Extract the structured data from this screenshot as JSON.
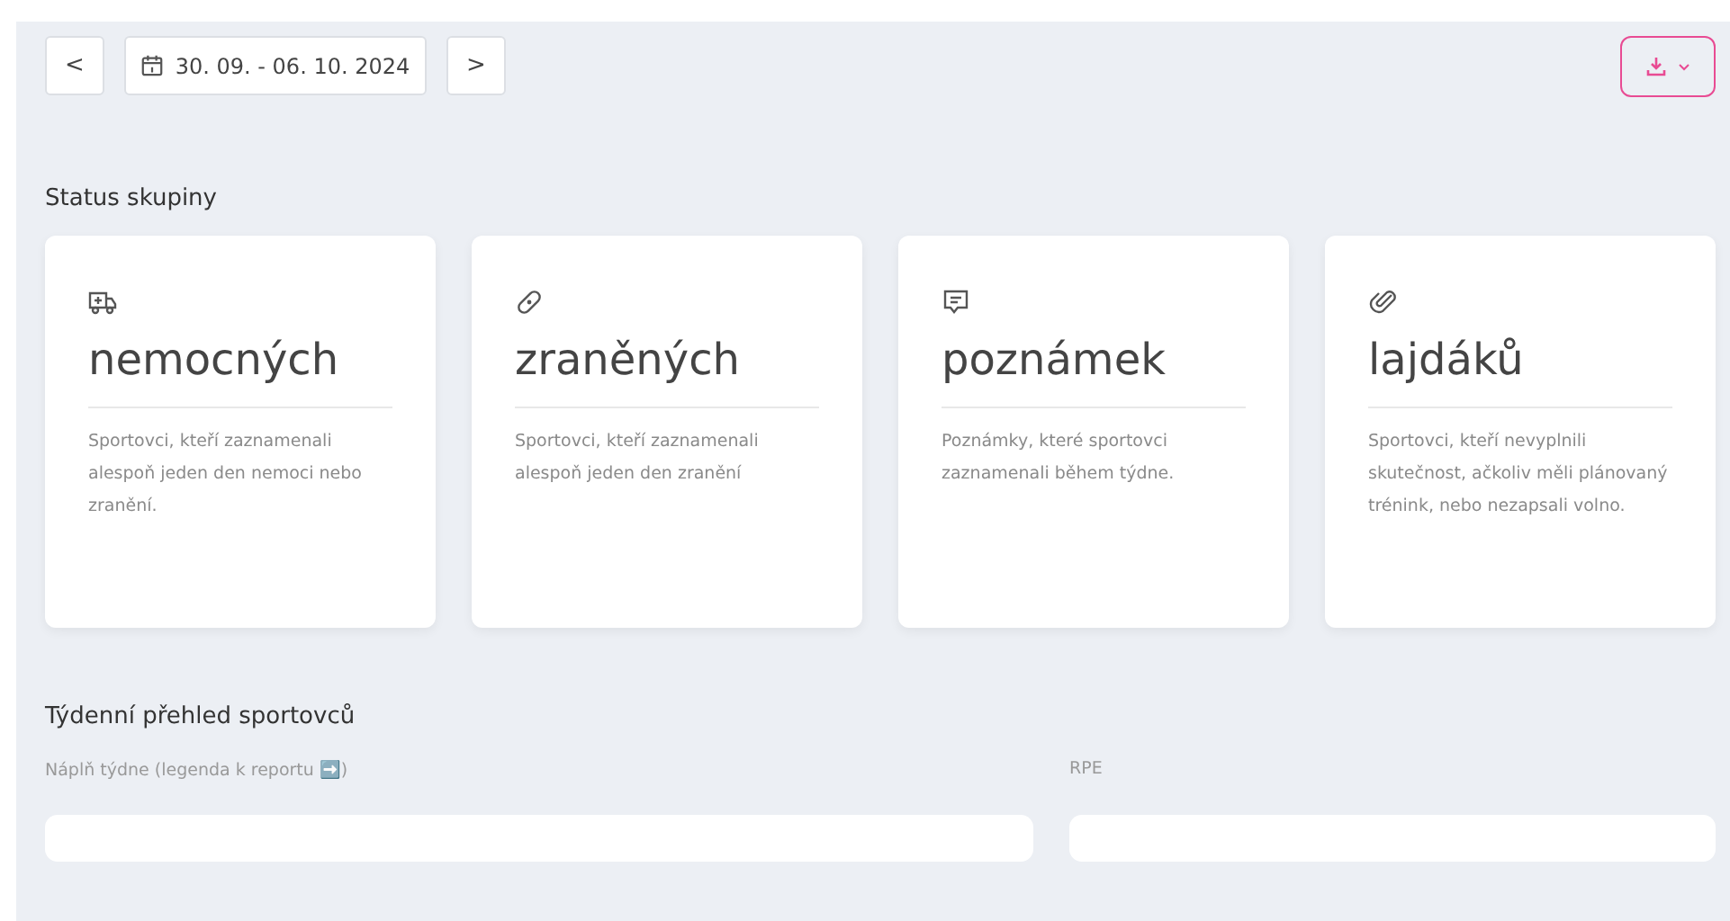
{
  "toolbar": {
    "prev": "<",
    "date_range": "30. 09. - 06. 10. 2024",
    "next": ">"
  },
  "status_title": "Status skupiny",
  "cards": [
    {
      "kind": "ambulance",
      "title": "nemocných",
      "description": "Sportovci, kteří zaznamenali alespoň jeden den nemoci nebo zranění."
    },
    {
      "kind": "bandage",
      "title": "zraněných",
      "description": "Sportovci, kteří zaznamenali alespoň jeden den zranění"
    },
    {
      "kind": "message",
      "title": "poznámek",
      "description": "Poznámky, které sportovci zaznamenali během týdne."
    },
    {
      "kind": "paperclip",
      "title": "lajdáků",
      "description": "Sportovci, kteří nevyplnili skutečnost, ačkoliv měli plánovaný trénink, nebo nezapsali volno."
    }
  ],
  "overview_title": "Týdenní přehled sportovců",
  "fields": [
    {
      "label": "Náplň týdne (legenda k reportu ➡️)"
    },
    {
      "label": "RPE"
    }
  ]
}
